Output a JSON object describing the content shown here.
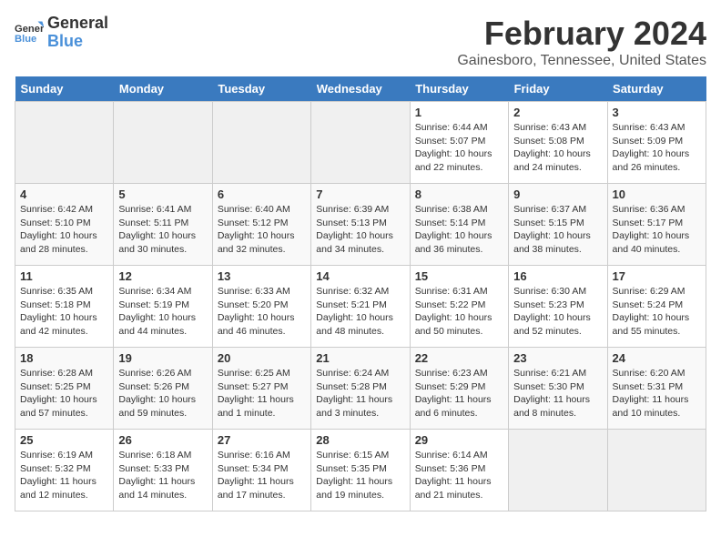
{
  "header": {
    "logo_line1": "General",
    "logo_line2": "Blue",
    "main_title": "February 2024",
    "subtitle": "Gainesboro, Tennessee, United States"
  },
  "days_of_week": [
    "Sunday",
    "Monday",
    "Tuesday",
    "Wednesday",
    "Thursday",
    "Friday",
    "Saturday"
  ],
  "weeks": [
    [
      {
        "day": "",
        "info": ""
      },
      {
        "day": "",
        "info": ""
      },
      {
        "day": "",
        "info": ""
      },
      {
        "day": "",
        "info": ""
      },
      {
        "day": "1",
        "info": "Sunrise: 6:44 AM\nSunset: 5:07 PM\nDaylight: 10 hours\nand 22 minutes."
      },
      {
        "day": "2",
        "info": "Sunrise: 6:43 AM\nSunset: 5:08 PM\nDaylight: 10 hours\nand 24 minutes."
      },
      {
        "day": "3",
        "info": "Sunrise: 6:43 AM\nSunset: 5:09 PM\nDaylight: 10 hours\nand 26 minutes."
      }
    ],
    [
      {
        "day": "4",
        "info": "Sunrise: 6:42 AM\nSunset: 5:10 PM\nDaylight: 10 hours\nand 28 minutes."
      },
      {
        "day": "5",
        "info": "Sunrise: 6:41 AM\nSunset: 5:11 PM\nDaylight: 10 hours\nand 30 minutes."
      },
      {
        "day": "6",
        "info": "Sunrise: 6:40 AM\nSunset: 5:12 PM\nDaylight: 10 hours\nand 32 minutes."
      },
      {
        "day": "7",
        "info": "Sunrise: 6:39 AM\nSunset: 5:13 PM\nDaylight: 10 hours\nand 34 minutes."
      },
      {
        "day": "8",
        "info": "Sunrise: 6:38 AM\nSunset: 5:14 PM\nDaylight: 10 hours\nand 36 minutes."
      },
      {
        "day": "9",
        "info": "Sunrise: 6:37 AM\nSunset: 5:15 PM\nDaylight: 10 hours\nand 38 minutes."
      },
      {
        "day": "10",
        "info": "Sunrise: 6:36 AM\nSunset: 5:17 PM\nDaylight: 10 hours\nand 40 minutes."
      }
    ],
    [
      {
        "day": "11",
        "info": "Sunrise: 6:35 AM\nSunset: 5:18 PM\nDaylight: 10 hours\nand 42 minutes."
      },
      {
        "day": "12",
        "info": "Sunrise: 6:34 AM\nSunset: 5:19 PM\nDaylight: 10 hours\nand 44 minutes."
      },
      {
        "day": "13",
        "info": "Sunrise: 6:33 AM\nSunset: 5:20 PM\nDaylight: 10 hours\nand 46 minutes."
      },
      {
        "day": "14",
        "info": "Sunrise: 6:32 AM\nSunset: 5:21 PM\nDaylight: 10 hours\nand 48 minutes."
      },
      {
        "day": "15",
        "info": "Sunrise: 6:31 AM\nSunset: 5:22 PM\nDaylight: 10 hours\nand 50 minutes."
      },
      {
        "day": "16",
        "info": "Sunrise: 6:30 AM\nSunset: 5:23 PM\nDaylight: 10 hours\nand 52 minutes."
      },
      {
        "day": "17",
        "info": "Sunrise: 6:29 AM\nSunset: 5:24 PM\nDaylight: 10 hours\nand 55 minutes."
      }
    ],
    [
      {
        "day": "18",
        "info": "Sunrise: 6:28 AM\nSunset: 5:25 PM\nDaylight: 10 hours\nand 57 minutes."
      },
      {
        "day": "19",
        "info": "Sunrise: 6:26 AM\nSunset: 5:26 PM\nDaylight: 10 hours\nand 59 minutes."
      },
      {
        "day": "20",
        "info": "Sunrise: 6:25 AM\nSunset: 5:27 PM\nDaylight: 11 hours\nand 1 minute."
      },
      {
        "day": "21",
        "info": "Sunrise: 6:24 AM\nSunset: 5:28 PM\nDaylight: 11 hours\nand 3 minutes."
      },
      {
        "day": "22",
        "info": "Sunrise: 6:23 AM\nSunset: 5:29 PM\nDaylight: 11 hours\nand 6 minutes."
      },
      {
        "day": "23",
        "info": "Sunrise: 6:21 AM\nSunset: 5:30 PM\nDaylight: 11 hours\nand 8 minutes."
      },
      {
        "day": "24",
        "info": "Sunrise: 6:20 AM\nSunset: 5:31 PM\nDaylight: 11 hours\nand 10 minutes."
      }
    ],
    [
      {
        "day": "25",
        "info": "Sunrise: 6:19 AM\nSunset: 5:32 PM\nDaylight: 11 hours\nand 12 minutes."
      },
      {
        "day": "26",
        "info": "Sunrise: 6:18 AM\nSunset: 5:33 PM\nDaylight: 11 hours\nand 14 minutes."
      },
      {
        "day": "27",
        "info": "Sunrise: 6:16 AM\nSunset: 5:34 PM\nDaylight: 11 hours\nand 17 minutes."
      },
      {
        "day": "28",
        "info": "Sunrise: 6:15 AM\nSunset: 5:35 PM\nDaylight: 11 hours\nand 19 minutes."
      },
      {
        "day": "29",
        "info": "Sunrise: 6:14 AM\nSunset: 5:36 PM\nDaylight: 11 hours\nand 21 minutes."
      },
      {
        "day": "",
        "info": ""
      },
      {
        "day": "",
        "info": ""
      }
    ]
  ]
}
